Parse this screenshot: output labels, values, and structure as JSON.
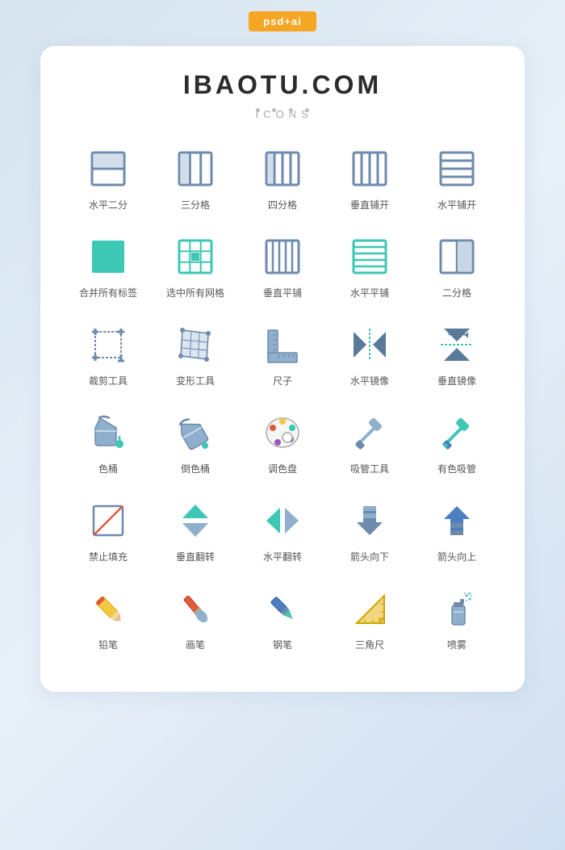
{
  "badge": "psd+ai",
  "title": "IBAOTU.COM",
  "subtitle": "ICONS",
  "icons": [
    {
      "id": "horizontal-split",
      "label": "水平二分",
      "type": "grid-h2"
    },
    {
      "id": "three-grid",
      "label": "三分格",
      "type": "grid-3"
    },
    {
      "id": "four-grid",
      "label": "四分格",
      "type": "grid-4"
    },
    {
      "id": "vertical-tile",
      "label": "垂直铺开",
      "type": "grid-vcols"
    },
    {
      "id": "horizontal-tile",
      "label": "水平铺开",
      "type": "grid-hrows"
    },
    {
      "id": "merge-all",
      "label": "合并所有标签",
      "type": "merge"
    },
    {
      "id": "select-all-grid",
      "label": "选中所有网格",
      "type": "select-grid"
    },
    {
      "id": "vertical-tile2",
      "label": "垂直平铺",
      "type": "grid-vcols2"
    },
    {
      "id": "horizontal-tile2",
      "label": "水平平铺",
      "type": "grid-hrows2"
    },
    {
      "id": "two-grid",
      "label": "二分格",
      "type": "grid-2split"
    },
    {
      "id": "crop",
      "label": "裁剪工具",
      "type": "crop"
    },
    {
      "id": "transform",
      "label": "变形工具",
      "type": "transform"
    },
    {
      "id": "ruler",
      "label": "尺子",
      "type": "ruler"
    },
    {
      "id": "mirror-h",
      "label": "水平镜像",
      "type": "mirror-h"
    },
    {
      "id": "mirror-v",
      "label": "垂直镜像",
      "type": "mirror-v"
    },
    {
      "id": "paint-bucket",
      "label": "色桶",
      "type": "bucket"
    },
    {
      "id": "flip-bucket",
      "label": "倒色桶",
      "type": "bucket-flip"
    },
    {
      "id": "color-palette",
      "label": "调色盘",
      "type": "palette"
    },
    {
      "id": "eyedropper",
      "label": "吸管工具",
      "type": "eyedropper"
    },
    {
      "id": "color-eyedropper",
      "label": "有色吸管",
      "type": "eyedropper-color"
    },
    {
      "id": "no-fill",
      "label": "禁止填充",
      "type": "no-fill"
    },
    {
      "id": "flip-v",
      "label": "垂直翻转",
      "type": "flip-v"
    },
    {
      "id": "flip-h",
      "label": "水平翻转",
      "type": "flip-h"
    },
    {
      "id": "arrow-down",
      "label": "箭头向下",
      "type": "arrow-down"
    },
    {
      "id": "arrow-up",
      "label": "箭头向上",
      "type": "arrow-up"
    },
    {
      "id": "pencil",
      "label": "铅笔",
      "type": "pencil"
    },
    {
      "id": "brush",
      "label": "画笔",
      "type": "brush"
    },
    {
      "id": "pen",
      "label": "钢笔",
      "type": "pen"
    },
    {
      "id": "triangle-ruler",
      "label": "三角尺",
      "type": "triangle-ruler"
    },
    {
      "id": "spray",
      "label": "喷雾",
      "type": "spray"
    }
  ],
  "colors": {
    "teal": "#3cc8b4",
    "slate": "#6e8aac",
    "dark-slate": "#5a7a9a",
    "light-slate": "#8fb0cc",
    "orange": "#f5a623",
    "red": "#e05a3a",
    "yellow": "#f5c842",
    "blue": "#4a7fc0",
    "green": "#3cc8b4",
    "bg": "#e8f0f8"
  }
}
